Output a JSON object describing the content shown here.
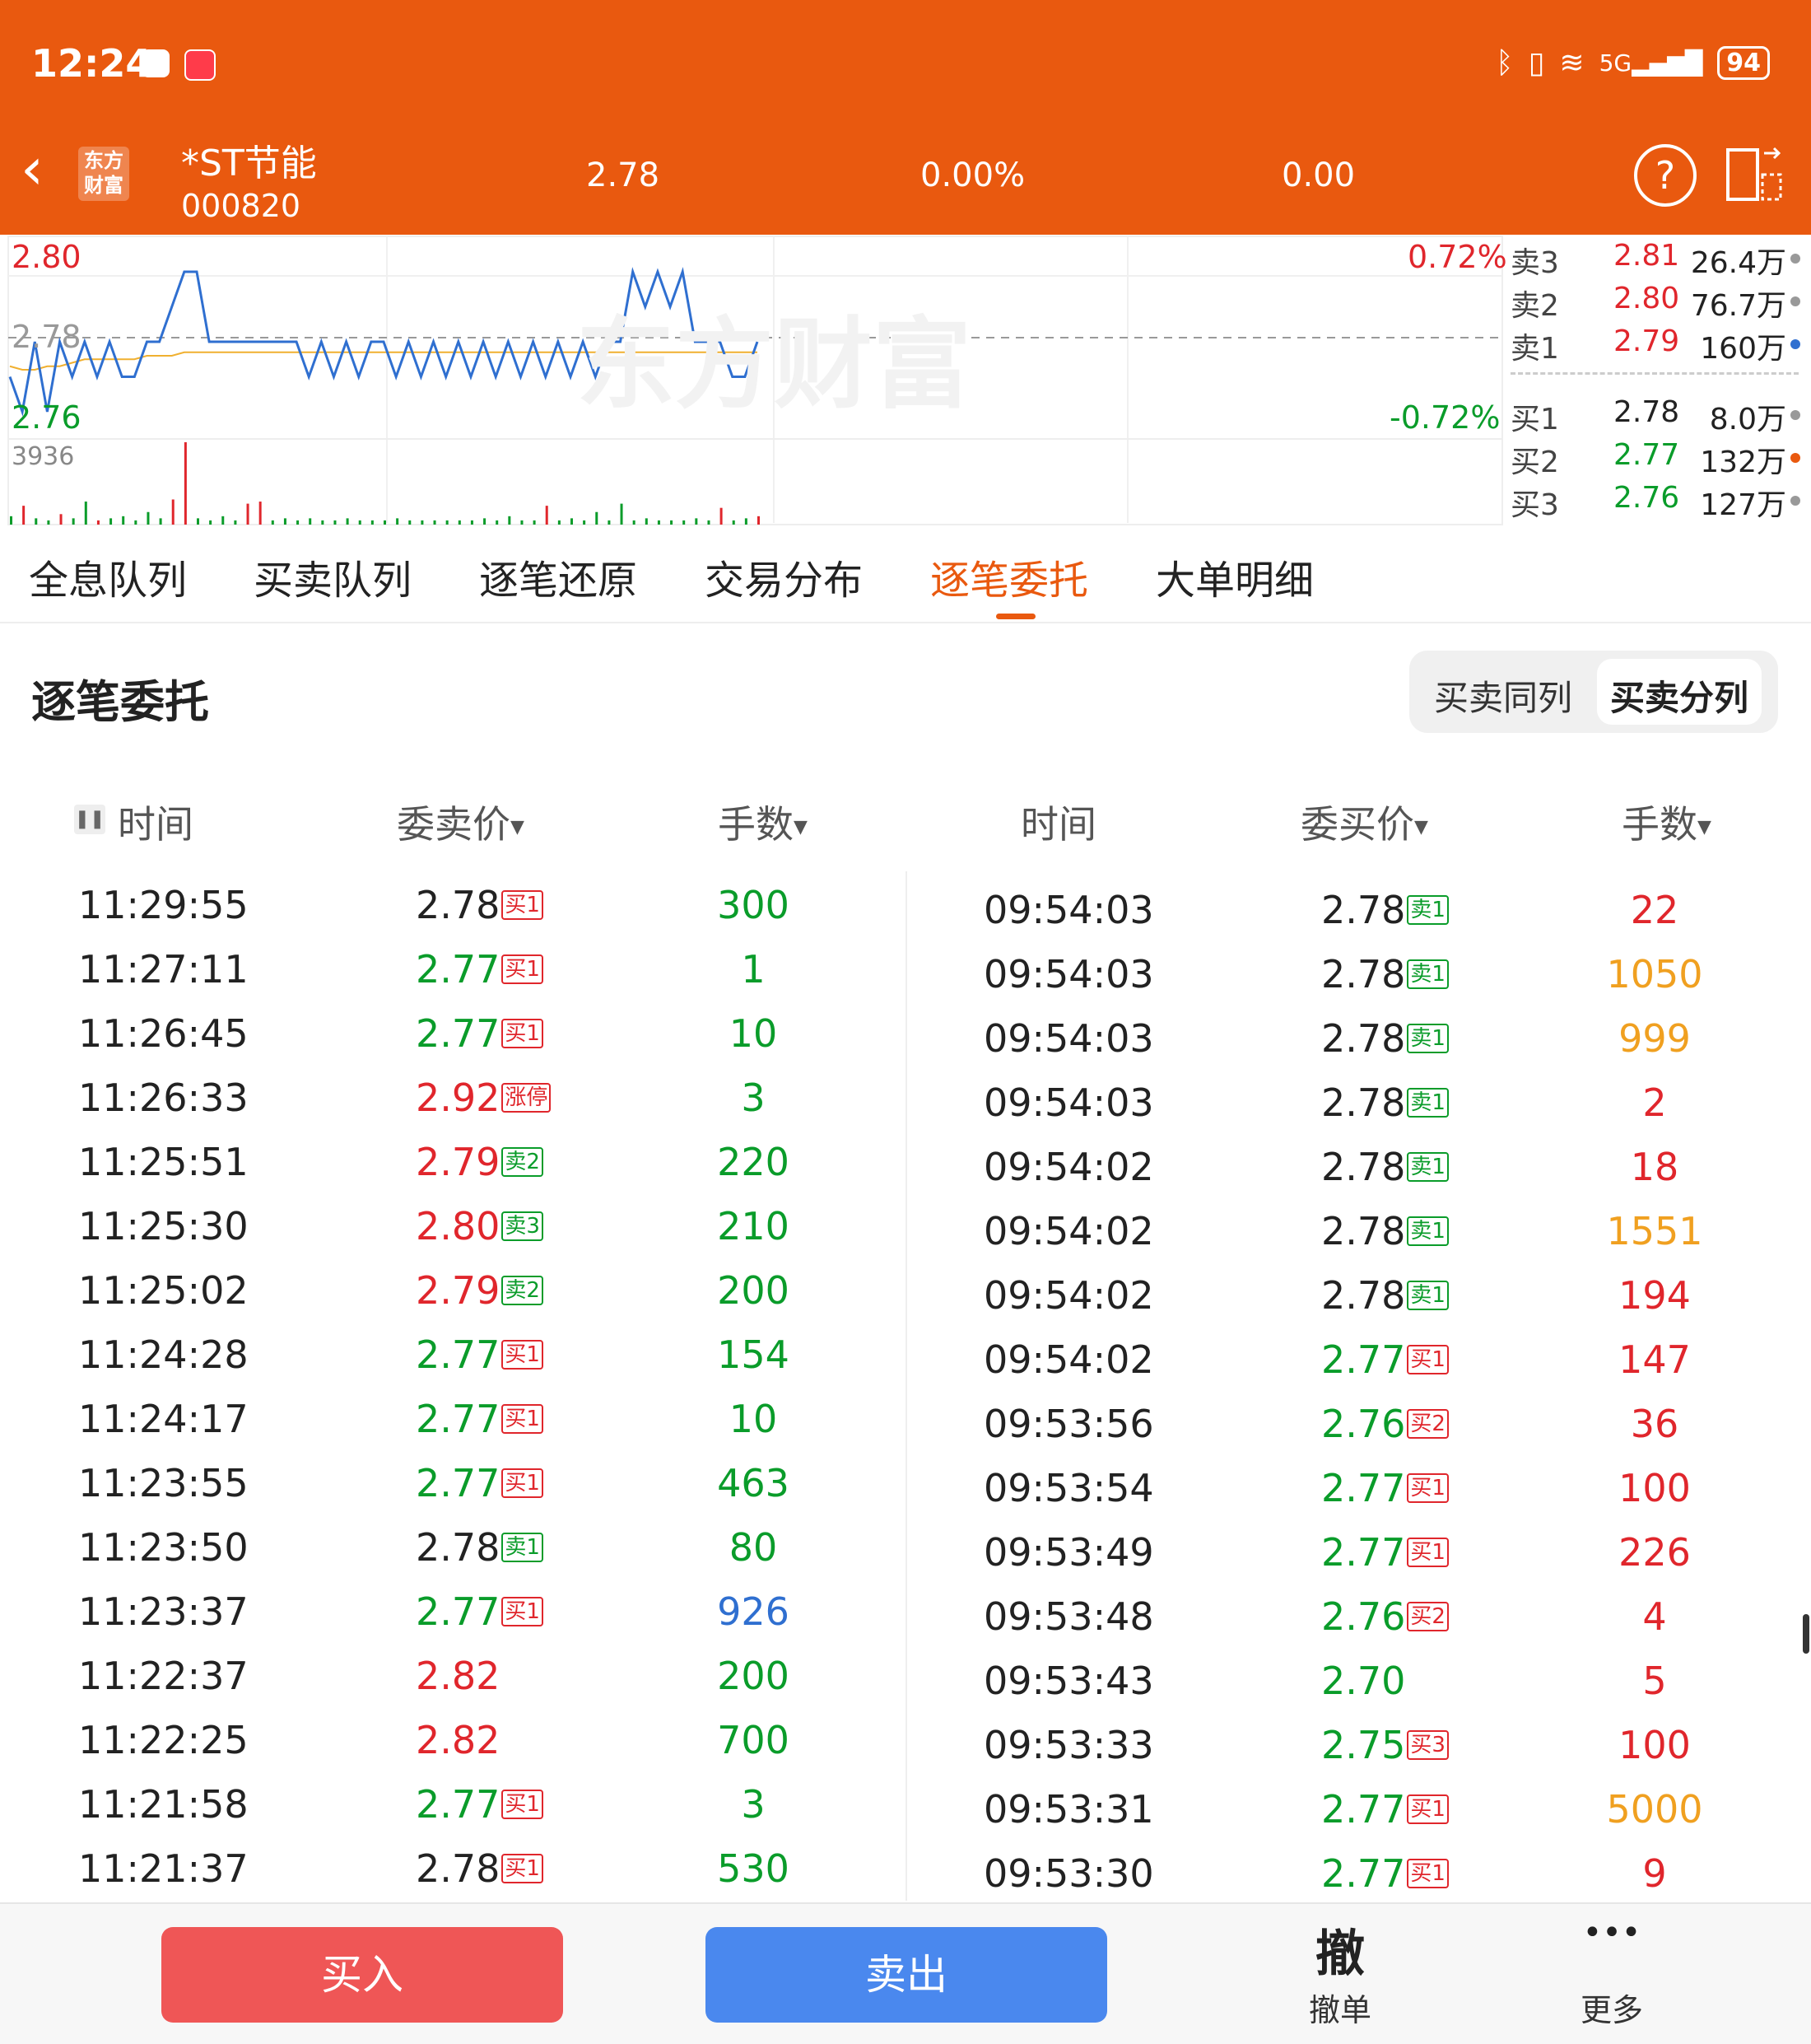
{
  "status": {
    "time": "12:24",
    "battery": "94",
    "network": "5G"
  },
  "header": {
    "logo_top": "东方",
    "logo_bottom": "财富",
    "name": "*ST节能",
    "code": "000820",
    "price": "2.78",
    "change_pct": "0.00%",
    "change": "0.00"
  },
  "chart": {
    "y_high": "2.80",
    "y_mid": "2.78",
    "y_low": "2.76",
    "pct_high": "0.72%",
    "pct_low": "-0.72%",
    "vol_max": "3936",
    "watermark": "东方财富"
  },
  "chart_data": {
    "type": "line",
    "ylim": [
      2.76,
      2.8
    ],
    "price_line": [
      2.77,
      2.76,
      2.78,
      2.76,
      2.78,
      2.77,
      2.78,
      2.77,
      2.78,
      2.77,
      2.77,
      2.78,
      2.78,
      2.79,
      2.8,
      2.8,
      2.78,
      2.78,
      2.78,
      2.78,
      2.78,
      2.78,
      2.78,
      2.78,
      2.77,
      2.78,
      2.77,
      2.78,
      2.77,
      2.78,
      2.78,
      2.77,
      2.78,
      2.77,
      2.78,
      2.77,
      2.78,
      2.77,
      2.78,
      2.77,
      2.78,
      2.77,
      2.78,
      2.77,
      2.78,
      2.77,
      2.78,
      2.77,
      2.78,
      2.78,
      2.8,
      2.79,
      2.8,
      2.79,
      2.8,
      2.78,
      2.78,
      2.78,
      2.77,
      2.77,
      2.78
    ],
    "avg_line": [
      2.773,
      2.772,
      2.772,
      2.773,
      2.773,
      2.774,
      2.775,
      2.775,
      2.775,
      2.775,
      2.775,
      2.776,
      2.776,
      2.776,
      2.777,
      2.777,
      2.777,
      2.777,
      2.777,
      2.777,
      2.777,
      2.777,
      2.777,
      2.777,
      2.777,
      2.777,
      2.777,
      2.777,
      2.777,
      2.777,
      2.777,
      2.777,
      2.777,
      2.777,
      2.777,
      2.777,
      2.777,
      2.777,
      2.777,
      2.777,
      2.777,
      2.777,
      2.777,
      2.777,
      2.777,
      2.777,
      2.777,
      2.777,
      2.777,
      2.777,
      2.777,
      2.777,
      2.777,
      2.777,
      2.777,
      2.777,
      2.777,
      2.777,
      2.777,
      2.777,
      2.777
    ],
    "volume": [
      400,
      900,
      300,
      200,
      500,
      300,
      1100,
      200,
      300,
      400,
      200,
      600,
      300,
      1200,
      3936,
      300,
      200,
      400,
      200,
      1000,
      1100,
      200,
      300,
      200,
      300,
      200,
      200,
      300,
      200,
      200,
      200,
      300,
      200,
      200,
      200,
      200,
      200,
      200,
      300,
      200,
      400,
      200,
      200,
      900,
      200,
      300,
      200,
      600,
      200,
      1000,
      200,
      300,
      200,
      200,
      200,
      300,
      200,
      800,
      200,
      300,
      400
    ],
    "volume_colors": [
      "green",
      "red",
      "green",
      "green",
      "red",
      "green",
      "green",
      "red",
      "green",
      "green",
      "green",
      "green",
      "green",
      "red",
      "red",
      "green",
      "green",
      "green",
      "green",
      "red",
      "red",
      "green",
      "green",
      "green",
      "green",
      "green",
      "green",
      "green",
      "green",
      "green",
      "green",
      "green",
      "green",
      "green",
      "green",
      "green",
      "green",
      "green",
      "green",
      "green",
      "green",
      "green",
      "green",
      "red",
      "green",
      "green",
      "green",
      "green",
      "green",
      "green",
      "green",
      "green",
      "green",
      "green",
      "green",
      "green",
      "green",
      "red",
      "green",
      "green",
      "red"
    ]
  },
  "orderbook": [
    {
      "label": "卖3",
      "price": "2.81",
      "vol": "26.4万",
      "price_color": "#e0262c",
      "dot": "#999999"
    },
    {
      "label": "卖2",
      "price": "2.80",
      "vol": "76.7万",
      "price_color": "#e0262c",
      "dot": "#999999"
    },
    {
      "label": "卖1",
      "price": "2.79",
      "vol": "160万",
      "price_color": "#e0262c",
      "dot": "#2f6fd0"
    },
    {
      "label": "买1",
      "price": "2.78",
      "vol": "8.0万",
      "price_color": "#222222",
      "dot": "#999999"
    },
    {
      "label": "买2",
      "price": "2.77",
      "vol": "132万",
      "price_color": "#0a9c2a",
      "dot": "#e9590f"
    },
    {
      "label": "买3",
      "price": "2.76",
      "vol": "127万",
      "price_color": "#0a9c2a",
      "dot": "#999999"
    }
  ],
  "tabs": [
    "全息队列",
    "买卖队列",
    "逐笔还原",
    "交易分布",
    "逐笔委托",
    "大单明细"
  ],
  "active_tab": "逐笔委托",
  "section": {
    "title": "逐笔委托",
    "seg_a": "买卖同列",
    "seg_b": "买卖分列"
  },
  "columns": {
    "left_time": "时间",
    "left_price": "委卖价",
    "left_qty": "手数",
    "right_time": "时间",
    "right_price": "委买价",
    "right_qty": "手数"
  },
  "sell_orders": [
    {
      "time": "11:29:55",
      "price": "2.78",
      "pc": "dark",
      "tag": "买1",
      "tc": "red",
      "qty": "300",
      "qc": "green"
    },
    {
      "time": "11:27:11",
      "price": "2.77",
      "pc": "green",
      "tag": "买1",
      "tc": "red",
      "qty": "1",
      "qc": "green"
    },
    {
      "time": "11:26:45",
      "price": "2.77",
      "pc": "green",
      "tag": "买1",
      "tc": "red",
      "qty": "10",
      "qc": "green"
    },
    {
      "time": "11:26:33",
      "price": "2.92",
      "pc": "red",
      "tag": "涨停",
      "tc": "red",
      "qty": "3",
      "qc": "green"
    },
    {
      "time": "11:25:51",
      "price": "2.79",
      "pc": "red",
      "tag": "卖2",
      "tc": "green",
      "qty": "220",
      "qc": "green"
    },
    {
      "time": "11:25:30",
      "price": "2.80",
      "pc": "red",
      "tag": "卖3",
      "tc": "green",
      "qty": "210",
      "qc": "green"
    },
    {
      "time": "11:25:02",
      "price": "2.79",
      "pc": "red",
      "tag": "卖2",
      "tc": "green",
      "qty": "200",
      "qc": "green"
    },
    {
      "time": "11:24:28",
      "price": "2.77",
      "pc": "green",
      "tag": "买1",
      "tc": "red",
      "qty": "154",
      "qc": "green"
    },
    {
      "time": "11:24:17",
      "price": "2.77",
      "pc": "green",
      "tag": "买1",
      "tc": "red",
      "qty": "10",
      "qc": "green"
    },
    {
      "time": "11:23:55",
      "price": "2.77",
      "pc": "green",
      "tag": "买1",
      "tc": "red",
      "qty": "463",
      "qc": "green"
    },
    {
      "time": "11:23:50",
      "price": "2.78",
      "pc": "dark",
      "tag": "卖1",
      "tc": "green",
      "qty": "80",
      "qc": "green"
    },
    {
      "time": "11:23:37",
      "price": "2.77",
      "pc": "green",
      "tag": "买1",
      "tc": "red",
      "qty": "926",
      "qc": "blue"
    },
    {
      "time": "11:22:37",
      "price": "2.82",
      "pc": "red",
      "tag": "",
      "tc": "red",
      "qty": "200",
      "qc": "green"
    },
    {
      "time": "11:22:25",
      "price": "2.82",
      "pc": "red",
      "tag": "",
      "tc": "red",
      "qty": "700",
      "qc": "green"
    },
    {
      "time": "11:21:58",
      "price": "2.77",
      "pc": "green",
      "tag": "买1",
      "tc": "red",
      "qty": "3",
      "qc": "green"
    },
    {
      "time": "11:21:37",
      "price": "2.78",
      "pc": "dark",
      "tag": "买1",
      "tc": "red",
      "qty": "530",
      "qc": "green"
    }
  ],
  "buy_orders": [
    {
      "time": "09:54:03",
      "price": "2.78",
      "pc": "dark",
      "tag": "卖1",
      "tc": "green",
      "qty": "22",
      "qc": "red"
    },
    {
      "time": "09:54:03",
      "price": "2.78",
      "pc": "dark",
      "tag": "卖1",
      "tc": "green",
      "qty": "1050",
      "qc": "orange"
    },
    {
      "time": "09:54:03",
      "price": "2.78",
      "pc": "dark",
      "tag": "卖1",
      "tc": "green",
      "qty": "999",
      "qc": "orange"
    },
    {
      "time": "09:54:03",
      "price": "2.78",
      "pc": "dark",
      "tag": "卖1",
      "tc": "green",
      "qty": "2",
      "qc": "red"
    },
    {
      "time": "09:54:02",
      "price": "2.78",
      "pc": "dark",
      "tag": "卖1",
      "tc": "green",
      "qty": "18",
      "qc": "red"
    },
    {
      "time": "09:54:02",
      "price": "2.78",
      "pc": "dark",
      "tag": "卖1",
      "tc": "green",
      "qty": "1551",
      "qc": "orange"
    },
    {
      "time": "09:54:02",
      "price": "2.78",
      "pc": "dark",
      "tag": "卖1",
      "tc": "green",
      "qty": "194",
      "qc": "red"
    },
    {
      "time": "09:54:02",
      "price": "2.77",
      "pc": "green",
      "tag": "买1",
      "tc": "red",
      "qty": "147",
      "qc": "red"
    },
    {
      "time": "09:53:56",
      "price": "2.76",
      "pc": "green",
      "tag": "买2",
      "tc": "red",
      "qty": "36",
      "qc": "red"
    },
    {
      "time": "09:53:54",
      "price": "2.77",
      "pc": "green",
      "tag": "买1",
      "tc": "red",
      "qty": "100",
      "qc": "red"
    },
    {
      "time": "09:53:49",
      "price": "2.77",
      "pc": "green",
      "tag": "买1",
      "tc": "red",
      "qty": "226",
      "qc": "red"
    },
    {
      "time": "09:53:48",
      "price": "2.76",
      "pc": "green",
      "tag": "买2",
      "tc": "red",
      "qty": "4",
      "qc": "red"
    },
    {
      "time": "09:53:43",
      "price": "2.70",
      "pc": "green",
      "tag": "",
      "tc": "red",
      "qty": "5",
      "qc": "red"
    },
    {
      "time": "09:53:33",
      "price": "2.75",
      "pc": "green",
      "tag": "买3",
      "tc": "red",
      "qty": "100",
      "qc": "red"
    },
    {
      "time": "09:53:31",
      "price": "2.77",
      "pc": "green",
      "tag": "买1",
      "tc": "red",
      "qty": "5000",
      "qc": "orange"
    },
    {
      "time": "09:53:30",
      "price": "2.77",
      "pc": "green",
      "tag": "买1",
      "tc": "red",
      "qty": "9",
      "qc": "red"
    }
  ],
  "bottom": {
    "buy": "买入",
    "sell": "卖出",
    "cancel_icon": "撤",
    "cancel": "撤单",
    "more_icon": "•••",
    "more": "更多"
  },
  "colors": {
    "brand": "#e9590f",
    "up": "#e0262c",
    "down": "#0a9c2a",
    "price_line": "#2f6fd0",
    "avg_line": "#f0b030"
  }
}
